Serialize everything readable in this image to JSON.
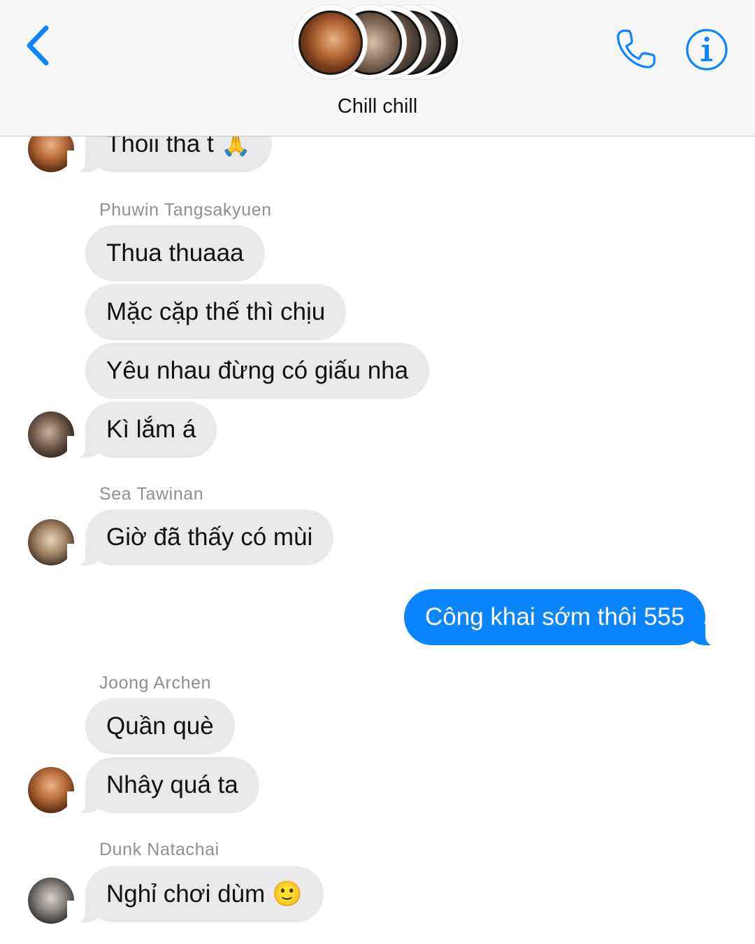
{
  "header": {
    "title": "Chill chill",
    "back_icon": "chevron-left-icon",
    "call_icon": "phone-icon",
    "info_icon": "info-icon",
    "accent_color": "#0b84ff"
  },
  "messages": [
    {
      "type": "received",
      "text": "Thoii tha t",
      "emoji": "🙏"
    },
    {
      "type": "sender",
      "name": "Phuwin Tangsakyuen"
    },
    {
      "type": "received",
      "text": "Thua thuaaa"
    },
    {
      "type": "received",
      "text": "Mặc cặp thế thì chịu"
    },
    {
      "type": "received",
      "text": "Yêu nhau đừng có giấu nha"
    },
    {
      "type": "received",
      "text": "Kì lắm á"
    },
    {
      "type": "sender",
      "name": "Sea Tawinan"
    },
    {
      "type": "received",
      "text": "Giờ đã thấy có mùi"
    },
    {
      "type": "sent",
      "text": "Công khai sớm thôi 555"
    },
    {
      "type": "sender",
      "name": "Joong Archen"
    },
    {
      "type": "received",
      "text": "Quần què"
    },
    {
      "type": "received",
      "text": "Nhây quá ta"
    },
    {
      "type": "sender",
      "name": "Dunk Natachai"
    },
    {
      "type": "received",
      "text": "Nghỉ chơi dùm",
      "emoji": "🙂"
    }
  ]
}
